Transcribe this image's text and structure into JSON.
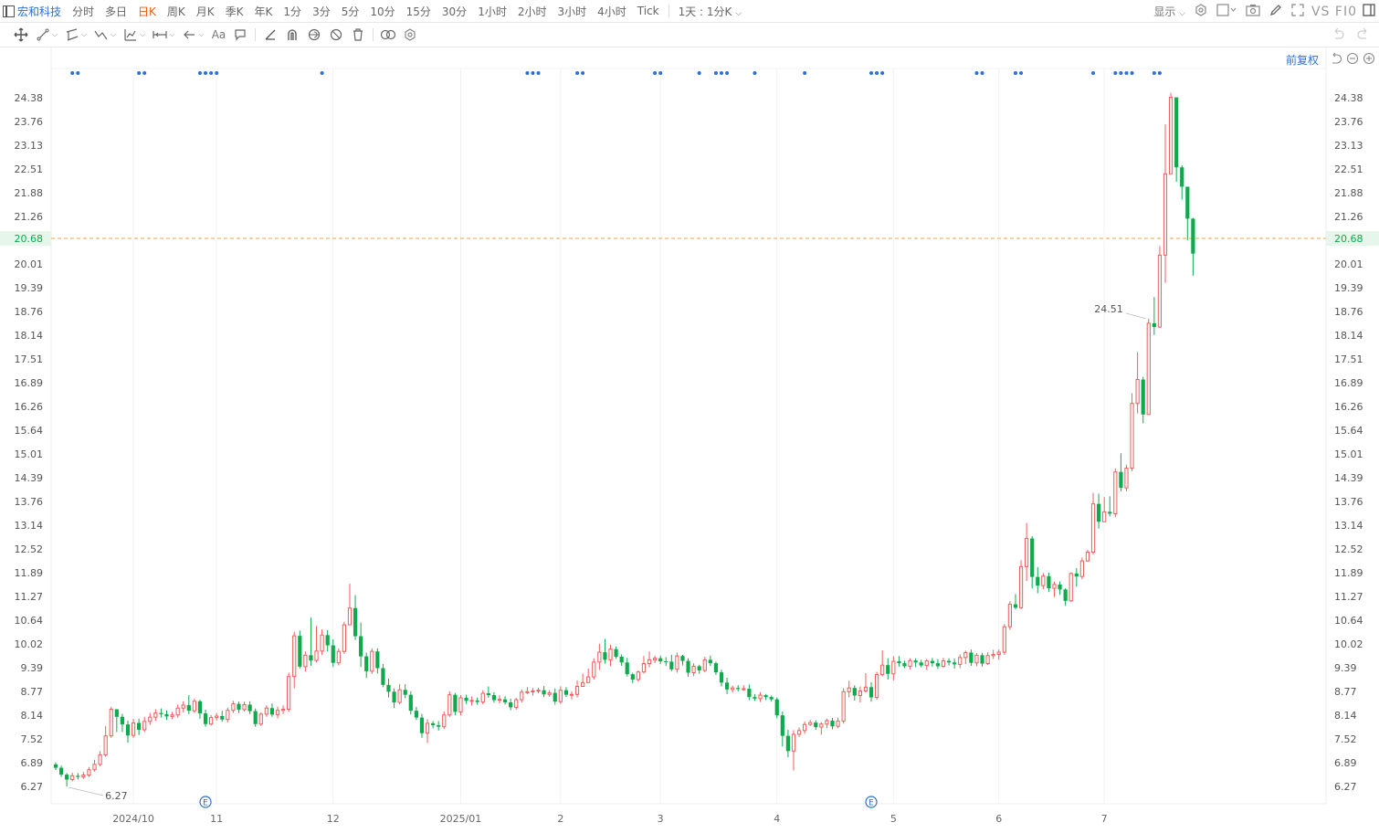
{
  "header": {
    "stock_name": "宏和科技",
    "timeframes": [
      "分时",
      "多日",
      "日K",
      "周K",
      "月K",
      "季K",
      "年K",
      "1分",
      "3分",
      "5分",
      "10分",
      "15分",
      "30分",
      "1小时",
      "2小时",
      "3小时",
      "4小时",
      "Tick"
    ],
    "active_timeframe": "日K",
    "mode": "1天 : 1分K",
    "display_label": "显示",
    "vs_label": "VS FI0"
  },
  "toolbar_icons": [
    "move-icon",
    "line-icon",
    "channel-icon",
    "wave-icon",
    "fib-icon",
    "measure-icon",
    "arrow-icon",
    "text-icon",
    "comment-icon",
    "ruler-icon",
    "magnet-icon",
    "eye-icon",
    "hide-icon",
    "trash-icon",
    "link-icon",
    "settings-icon"
  ],
  "adjust_label": "前复权",
  "colors": {
    "up": "#f25c5c",
    "down": "#0eaa4e",
    "accent": "#2a70d8",
    "current": "#f0a040"
  },
  "chart_data": {
    "type": "candlestick",
    "y_ticks": [
      "24.38",
      "23.76",
      "23.13",
      "22.51",
      "21.88",
      "21.26",
      "20.68",
      "20.01",
      "19.39",
      "18.76",
      "18.14",
      "17.51",
      "16.89",
      "16.26",
      "15.64",
      "15.01",
      "14.39",
      "13.76",
      "13.14",
      "12.52",
      "11.89",
      "11.27",
      "10.64",
      "10.02",
      "9.39",
      "8.77",
      "8.14",
      "7.52",
      "6.89",
      "6.27"
    ],
    "ylim": [
      5.9,
      24.8
    ],
    "x_ticks": [
      {
        "label": "2024/10",
        "index": 14
      },
      {
        "label": "11",
        "index": 29
      },
      {
        "label": "12",
        "index": 50
      },
      {
        "label": "2025/01",
        "index": 73
      },
      {
        "label": "2",
        "index": 91
      },
      {
        "label": "3",
        "index": 109
      },
      {
        "label": "4",
        "index": 130
      },
      {
        "label": "5",
        "index": 151
      },
      {
        "label": "6",
        "index": 170
      },
      {
        "label": "7",
        "index": 189
      }
    ],
    "current_price": "20.68",
    "high_marker": {
      "label": "24.51",
      "index": 197
    },
    "low_marker": {
      "label": "6.27",
      "index": 2
    },
    "event_markers": [
      {
        "label": "E",
        "index": 27
      },
      {
        "label": "E",
        "index": 147
      }
    ],
    "dot_indices": [
      3,
      4,
      15,
      16,
      26,
      27,
      28,
      29,
      48,
      85,
      86,
      87,
      94,
      95,
      108,
      109,
      116,
      119,
      120,
      121,
      126,
      135,
      147,
      148,
      149,
      166,
      167,
      173,
      174,
      187,
      191,
      192,
      193,
      194,
      198,
      199
    ],
    "candles": [
      [
        6.85,
        6.76,
        6.9,
        6.7
      ],
      [
        6.76,
        6.58,
        6.82,
        6.52
      ],
      [
        6.58,
        6.45,
        6.62,
        6.27
      ],
      [
        6.45,
        6.55,
        6.63,
        6.4
      ],
      [
        6.55,
        6.52,
        6.62,
        6.45
      ],
      [
        6.52,
        6.57,
        6.65,
        6.47
      ],
      [
        6.57,
        6.71,
        6.78,
        6.52
      ],
      [
        6.71,
        6.85,
        6.97,
        6.66
      ],
      [
        6.85,
        7.1,
        7.2,
        6.8
      ],
      [
        7.1,
        7.6,
        7.86,
        7.05
      ],
      [
        7.6,
        8.3,
        8.36,
        7.55
      ],
      [
        8.3,
        8.1,
        8.3,
        7.7
      ],
      [
        8.1,
        7.9,
        8.18,
        7.7
      ],
      [
        7.9,
        7.61,
        8.0,
        7.42
      ],
      [
        7.61,
        7.94,
        8.05,
        7.55
      ],
      [
        7.94,
        7.76,
        8.05,
        7.62
      ],
      [
        7.76,
        7.98,
        8.1,
        7.7
      ],
      [
        7.98,
        8.09,
        8.2,
        7.89
      ],
      [
        8.09,
        8.2,
        8.3,
        8.0
      ],
      [
        8.2,
        8.17,
        8.32,
        8.08
      ],
      [
        8.17,
        8.11,
        8.27,
        8.02
      ],
      [
        8.11,
        8.15,
        8.23,
        8.04
      ],
      [
        8.15,
        8.33,
        8.42,
        8.08
      ],
      [
        8.33,
        8.41,
        8.51,
        8.22
      ],
      [
        8.41,
        8.26,
        8.67,
        8.17
      ],
      [
        8.26,
        8.51,
        8.58,
        8.2
      ],
      [
        8.51,
        8.19,
        8.55,
        8.05
      ],
      [
        8.19,
        7.91,
        8.29,
        7.84
      ],
      [
        7.91,
        8.08,
        8.15,
        7.87
      ],
      [
        8.08,
        8.12,
        8.2,
        8.0
      ],
      [
        8.12,
        8.03,
        8.26,
        7.97
      ],
      [
        8.03,
        8.27,
        8.34,
        7.95
      ],
      [
        8.27,
        8.44,
        8.52,
        8.2
      ],
      [
        8.44,
        8.29,
        8.5,
        8.2
      ],
      [
        8.29,
        8.42,
        8.5,
        8.24
      ],
      [
        8.42,
        8.25,
        8.51,
        8.17
      ],
      [
        8.25,
        7.91,
        8.32,
        7.84
      ],
      [
        7.91,
        8.17,
        8.22,
        7.86
      ],
      [
        8.17,
        8.33,
        8.4,
        8.1
      ],
      [
        8.33,
        8.16,
        8.45,
        8.1
      ],
      [
        8.16,
        8.27,
        8.37,
        8.06
      ],
      [
        8.27,
        8.3,
        8.4,
        8.17
      ],
      [
        8.3,
        9.16,
        9.26,
        8.23
      ],
      [
        9.16,
        10.23,
        10.34,
        8.85
      ],
      [
        10.23,
        9.42,
        10.37,
        9.37
      ],
      [
        9.42,
        9.72,
        9.82,
        9.29
      ],
      [
        9.72,
        9.58,
        10.71,
        9.44
      ],
      [
        9.58,
        9.83,
        10.49,
        9.53
      ],
      [
        9.83,
        10.25,
        10.4,
        9.73
      ],
      [
        10.25,
        9.98,
        10.38,
        9.82
      ],
      [
        9.98,
        9.52,
        10.14,
        9.41
      ],
      [
        9.52,
        9.82,
        9.9,
        9.45
      ],
      [
        9.82,
        10.52,
        10.6,
        9.76
      ],
      [
        10.52,
        10.96,
        11.6,
        10.55
      ],
      [
        10.96,
        10.22,
        11.3,
        10.12
      ],
      [
        10.22,
        9.69,
        10.58,
        9.41
      ],
      [
        9.69,
        9.3,
        9.79,
        9.12
      ],
      [
        9.3,
        9.82,
        9.9,
        9.23
      ],
      [
        9.82,
        9.38,
        9.9,
        9.24
      ],
      [
        9.38,
        8.94,
        9.49,
        8.88
      ],
      [
        8.94,
        8.76,
        9.1,
        8.61
      ],
      [
        8.76,
        8.48,
        8.85,
        8.33
      ],
      [
        8.48,
        8.81,
        8.96,
        8.43
      ],
      [
        8.81,
        8.68,
        8.96,
        8.59
      ],
      [
        8.68,
        8.26,
        8.77,
        8.16
      ],
      [
        8.26,
        8.08,
        8.36,
        8.02
      ],
      [
        8.08,
        7.67,
        8.18,
        7.55
      ],
      [
        7.67,
        7.93,
        8.04,
        7.41
      ],
      [
        7.93,
        7.88,
        7.99,
        7.8
      ],
      [
        7.88,
        7.84,
        7.99,
        7.74
      ],
      [
        7.84,
        8.15,
        8.24,
        7.78
      ],
      [
        8.15,
        8.68,
        8.77,
        8.1
      ],
      [
        8.68,
        8.23,
        8.73,
        8.14
      ],
      [
        8.23,
        8.6,
        8.67,
        8.14
      ],
      [
        8.6,
        8.52,
        8.68,
        8.44
      ],
      [
        8.52,
        8.53,
        8.64,
        8.4
      ],
      [
        8.53,
        8.49,
        8.61,
        8.42
      ],
      [
        8.49,
        8.72,
        8.8,
        8.43
      ],
      [
        8.72,
        8.67,
        8.9,
        8.6
      ],
      [
        8.67,
        8.54,
        8.75,
        8.47
      ],
      [
        8.54,
        8.56,
        8.67,
        8.45
      ],
      [
        8.56,
        8.48,
        8.64,
        8.42
      ],
      [
        8.48,
        8.35,
        8.58,
        8.27
      ],
      [
        8.35,
        8.55,
        8.6,
        8.29
      ],
      [
        8.55,
        8.75,
        8.82,
        8.48
      ],
      [
        8.75,
        8.76,
        8.88,
        8.7
      ],
      [
        8.76,
        8.78,
        8.86,
        8.66
      ],
      [
        8.78,
        8.8,
        8.86,
        8.72
      ],
      [
        8.8,
        8.69,
        8.91,
        8.62
      ],
      [
        8.69,
        8.73,
        8.8,
        8.63
      ],
      [
        8.73,
        8.5,
        8.85,
        8.42
      ],
      [
        8.5,
        8.8,
        8.9,
        8.44
      ],
      [
        8.8,
        8.68,
        8.88,
        8.62
      ],
      [
        8.68,
        8.69,
        8.77,
        8.56
      ],
      [
        8.69,
        8.9,
        9.06,
        8.61
      ],
      [
        8.9,
        9.0,
        9.24,
        8.9
      ],
      [
        9.0,
        9.15,
        9.37,
        9.09
      ],
      [
        9.15,
        9.54,
        9.64,
        9.08
      ],
      [
        9.54,
        9.8,
        10.02,
        9.33
      ],
      [
        9.8,
        9.6,
        10.15,
        9.5
      ],
      [
        9.6,
        9.88,
        10.0,
        9.43
      ],
      [
        9.88,
        9.68,
        9.95,
        9.63
      ],
      [
        9.68,
        9.53,
        9.74,
        9.44
      ],
      [
        9.53,
        9.22,
        9.65,
        9.16
      ],
      [
        9.22,
        9.08,
        9.26,
        8.99
      ],
      [
        9.08,
        9.28,
        9.32,
        9.02
      ],
      [
        9.28,
        9.5,
        9.7,
        9.24
      ],
      [
        9.5,
        9.6,
        9.82,
        9.4
      ],
      [
        9.6,
        9.64,
        9.71,
        9.51
      ],
      [
        9.64,
        9.56,
        9.71,
        9.49
      ],
      [
        9.56,
        9.55,
        9.67,
        9.44
      ],
      [
        9.55,
        9.35,
        9.73,
        9.3
      ],
      [
        9.35,
        9.7,
        9.79,
        9.26
      ],
      [
        9.7,
        9.57,
        9.73,
        9.45
      ],
      [
        9.57,
        9.26,
        9.64,
        9.15
      ],
      [
        9.26,
        9.43,
        9.51,
        9.17
      ],
      [
        9.43,
        9.32,
        9.47,
        9.23
      ],
      [
        9.32,
        9.6,
        9.68,
        9.27
      ],
      [
        9.6,
        9.51,
        9.71,
        9.44
      ],
      [
        9.51,
        9.27,
        9.55,
        9.2
      ],
      [
        9.27,
        9.0,
        9.34,
        8.9
      ],
      [
        9.0,
        8.82,
        9.13,
        8.7
      ],
      [
        8.82,
        8.86,
        8.92,
        8.74
      ],
      [
        8.86,
        8.83,
        8.93,
        8.77
      ],
      [
        8.83,
        8.84,
        8.93,
        8.78
      ],
      [
        8.84,
        8.62,
        8.95,
        8.54
      ],
      [
        8.62,
        8.58,
        8.7,
        8.52
      ],
      [
        8.58,
        8.67,
        8.75,
        8.49
      ],
      [
        8.67,
        8.62,
        8.7,
        8.54
      ],
      [
        8.62,
        8.56,
        8.66,
        8.5
      ],
      [
        8.56,
        8.14,
        8.61,
        8.06
      ],
      [
        8.14,
        7.6,
        8.24,
        7.32
      ],
      [
        7.6,
        7.2,
        7.76,
        7.04
      ],
      [
        7.2,
        7.64,
        7.75,
        6.69
      ],
      [
        7.64,
        7.74,
        7.82,
        7.57
      ],
      [
        7.74,
        7.9,
        7.98,
        7.65
      ],
      [
        7.9,
        7.95,
        8.02,
        7.86
      ],
      [
        7.95,
        7.83,
        8.01,
        7.76
      ],
      [
        7.83,
        7.91,
        7.96,
        7.63
      ],
      [
        7.91,
        8.0,
        8.05,
        7.8
      ],
      [
        8.0,
        7.85,
        8.07,
        7.77
      ],
      [
        7.85,
        7.99,
        8.08,
        7.8
      ],
      [
        7.99,
        8.76,
        8.85,
        7.92
      ],
      [
        8.76,
        8.86,
        9.05,
        8.61
      ],
      [
        8.86,
        8.66,
        8.93,
        8.53
      ],
      [
        8.66,
        8.78,
        8.9,
        8.48
      ],
      [
        8.78,
        8.88,
        9.25,
        8.74
      ],
      [
        8.88,
        8.61,
        9.01,
        8.5
      ],
      [
        8.61,
        9.21,
        9.28,
        8.55
      ],
      [
        9.21,
        9.46,
        9.85,
        9.16
      ],
      [
        9.46,
        9.23,
        9.64,
        9.08
      ],
      [
        9.23,
        9.56,
        9.69,
        9.06
      ],
      [
        9.56,
        9.51,
        9.7,
        9.42
      ],
      [
        9.51,
        9.43,
        9.58,
        9.38
      ],
      [
        9.43,
        9.58,
        9.64,
        9.35
      ],
      [
        9.58,
        9.53,
        9.64,
        9.41
      ],
      [
        9.53,
        9.45,
        9.6,
        9.4
      ],
      [
        9.45,
        9.57,
        9.62,
        9.33
      ],
      [
        9.57,
        9.51,
        9.65,
        9.42
      ],
      [
        9.51,
        9.43,
        9.62,
        9.36
      ],
      [
        9.43,
        9.57,
        9.65,
        9.39
      ],
      [
        9.57,
        9.53,
        9.64,
        9.45
      ],
      [
        9.53,
        9.48,
        9.63,
        9.37
      ],
      [
        9.48,
        9.66,
        9.74,
        9.38
      ],
      [
        9.66,
        9.79,
        9.84,
        9.49
      ],
      [
        9.79,
        9.52,
        9.87,
        9.44
      ],
      [
        9.52,
        9.72,
        9.78,
        9.43
      ],
      [
        9.72,
        9.5,
        9.78,
        9.42
      ],
      [
        9.5,
        9.71,
        9.8,
        9.46
      ],
      [
        9.71,
        9.74,
        9.86,
        9.62
      ],
      [
        9.74,
        9.8,
        9.87,
        9.6
      ],
      [
        9.8,
        10.47,
        10.54,
        9.73
      ],
      [
        10.47,
        11.06,
        11.14,
        10.39
      ],
      [
        11.06,
        10.97,
        11.33,
        10.93
      ],
      [
        10.97,
        12.05,
        12.22,
        10.93
      ],
      [
        12.05,
        12.79,
        13.2,
        11.67
      ],
      [
        12.79,
        11.78,
        12.85,
        11.48
      ],
      [
        11.78,
        11.55,
        12.04,
        11.35
      ],
      [
        11.55,
        11.8,
        11.88,
        11.46
      ],
      [
        11.8,
        11.48,
        11.89,
        11.38
      ],
      [
        11.48,
        11.58,
        11.65,
        11.25
      ],
      [
        11.58,
        11.45,
        11.66,
        11.31
      ],
      [
        11.45,
        11.15,
        11.48,
        11.02
      ],
      [
        11.15,
        11.87,
        11.9,
        11.12
      ],
      [
        11.87,
        11.79,
        12.01,
        11.52
      ],
      [
        11.79,
        12.2,
        12.29,
        11.72
      ],
      [
        12.2,
        12.43,
        12.49,
        12.18
      ],
      [
        12.43,
        13.7,
        13.99,
        12.37
      ],
      [
        13.7,
        13.23,
        13.97,
        13.05
      ],
      [
        13.23,
        13.49,
        13.88,
        13.25
      ],
      [
        13.49,
        13.44,
        13.9,
        13.37
      ],
      [
        13.44,
        14.54,
        14.63,
        13.35
      ],
      [
        14.54,
        14.12,
        15.03,
        14.03
      ],
      [
        14.12,
        14.64,
        14.73,
        14.03
      ],
      [
        14.64,
        16.34,
        16.61,
        14.56
      ],
      [
        16.34,
        16.97,
        17.69,
        16.08
      ],
      [
        16.97,
        16.05,
        17.04,
        15.82
      ],
      [
        16.05,
        18.45,
        18.57,
        18.1
      ],
      [
        18.45,
        18.35,
        19.14,
        18.14
      ],
      [
        18.35,
        20.24,
        20.48,
        18.33
      ],
      [
        20.24,
        22.38,
        23.68,
        19.51
      ],
      [
        22.38,
        24.39,
        24.51,
        23.09
      ],
      [
        24.39,
        22.55,
        23.56,
        22.17
      ],
      [
        22.55,
        22.04,
        22.6,
        21.7
      ],
      [
        22.04,
        21.2,
        21.84,
        20.63
      ],
      [
        21.2,
        20.28,
        21.22,
        19.7
      ]
    ]
  }
}
